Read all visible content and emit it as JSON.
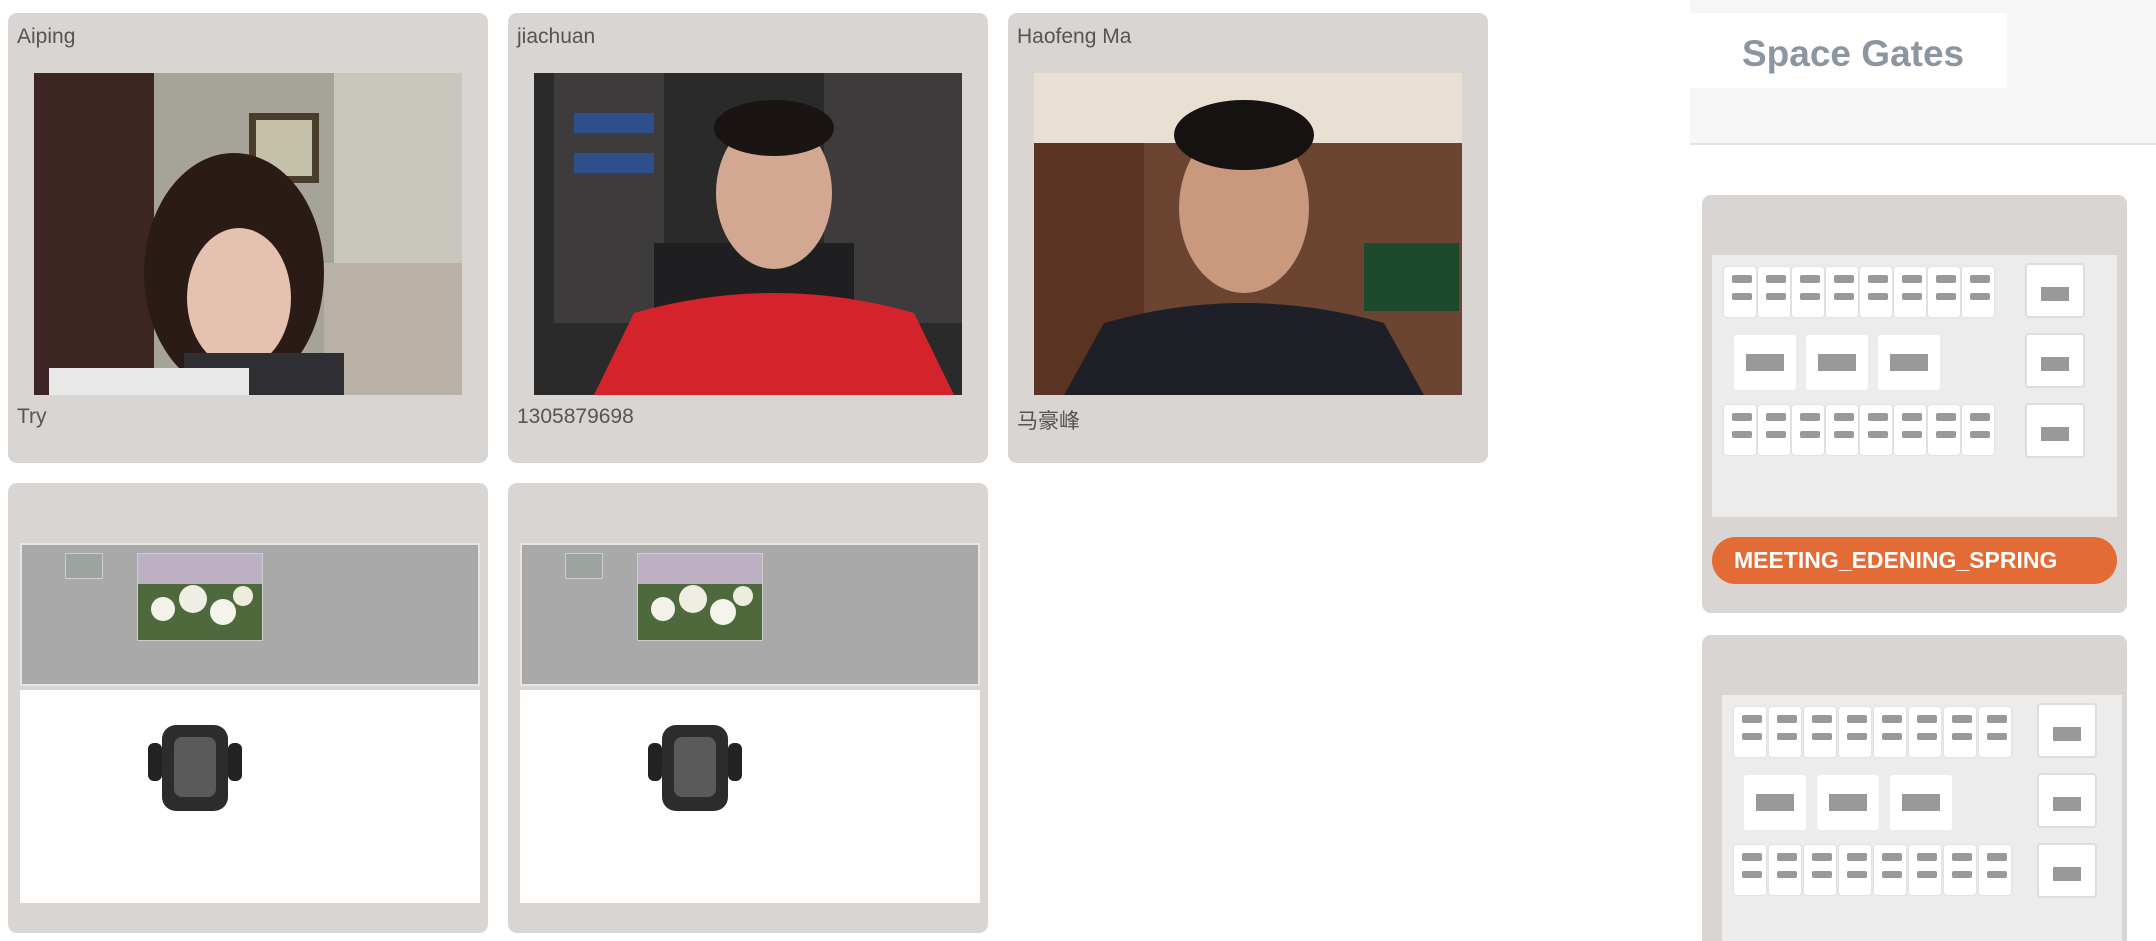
{
  "participants": [
    {
      "name": "Aiping",
      "subtitle": "Try"
    },
    {
      "name": "jiachuan",
      "subtitle": "1305879698"
    },
    {
      "name": "Haofeng Ma",
      "subtitle": "马豪峰"
    }
  ],
  "panel": {
    "title": "Space Gates",
    "gates": [
      {
        "label": "MEETING_EDENING_SPRING"
      },
      {
        "label": ""
      }
    ]
  },
  "colors": {
    "card_bg": "#d8d5d3",
    "gate_button": "#e36b35",
    "title": "#8c96a0"
  }
}
